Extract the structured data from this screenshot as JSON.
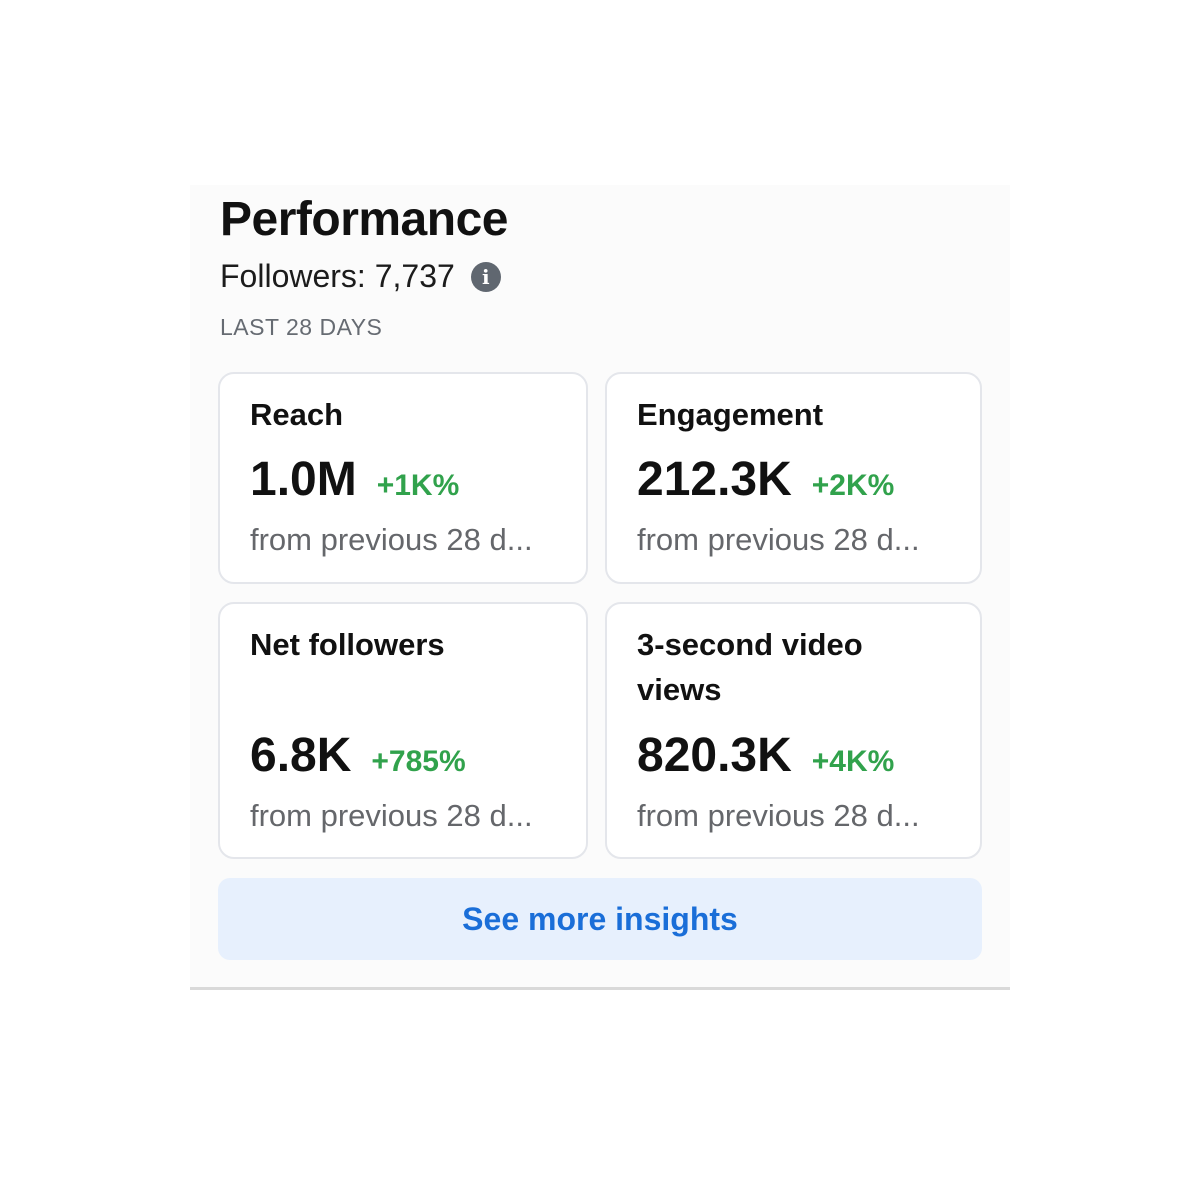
{
  "header": {
    "title": "Performance",
    "followers": "Followers: 7,737",
    "info_icon": "info-icon",
    "range_label": "LAST 28 DAYS"
  },
  "metrics": [
    {
      "title": "Reach",
      "value": "1.0M",
      "delta": "+1K%",
      "sub": "from previous 28 d..."
    },
    {
      "title": "Engagement",
      "value": "212.3K",
      "delta": "+2K%",
      "sub": "from previous 28 d..."
    },
    {
      "title": "Net followers",
      "value": "6.8K",
      "delta": "+785%",
      "sub": "from previous 28 d..."
    },
    {
      "title": "3-second video views",
      "value": "820.3K",
      "delta": "+4K%",
      "sub": "from previous 28 d..."
    }
  ],
  "cta": {
    "label": "See more insights"
  },
  "colors": {
    "positive_delta": "#31a24c",
    "link": "#1a6ed8",
    "cta_background": "#e7f0fd"
  }
}
